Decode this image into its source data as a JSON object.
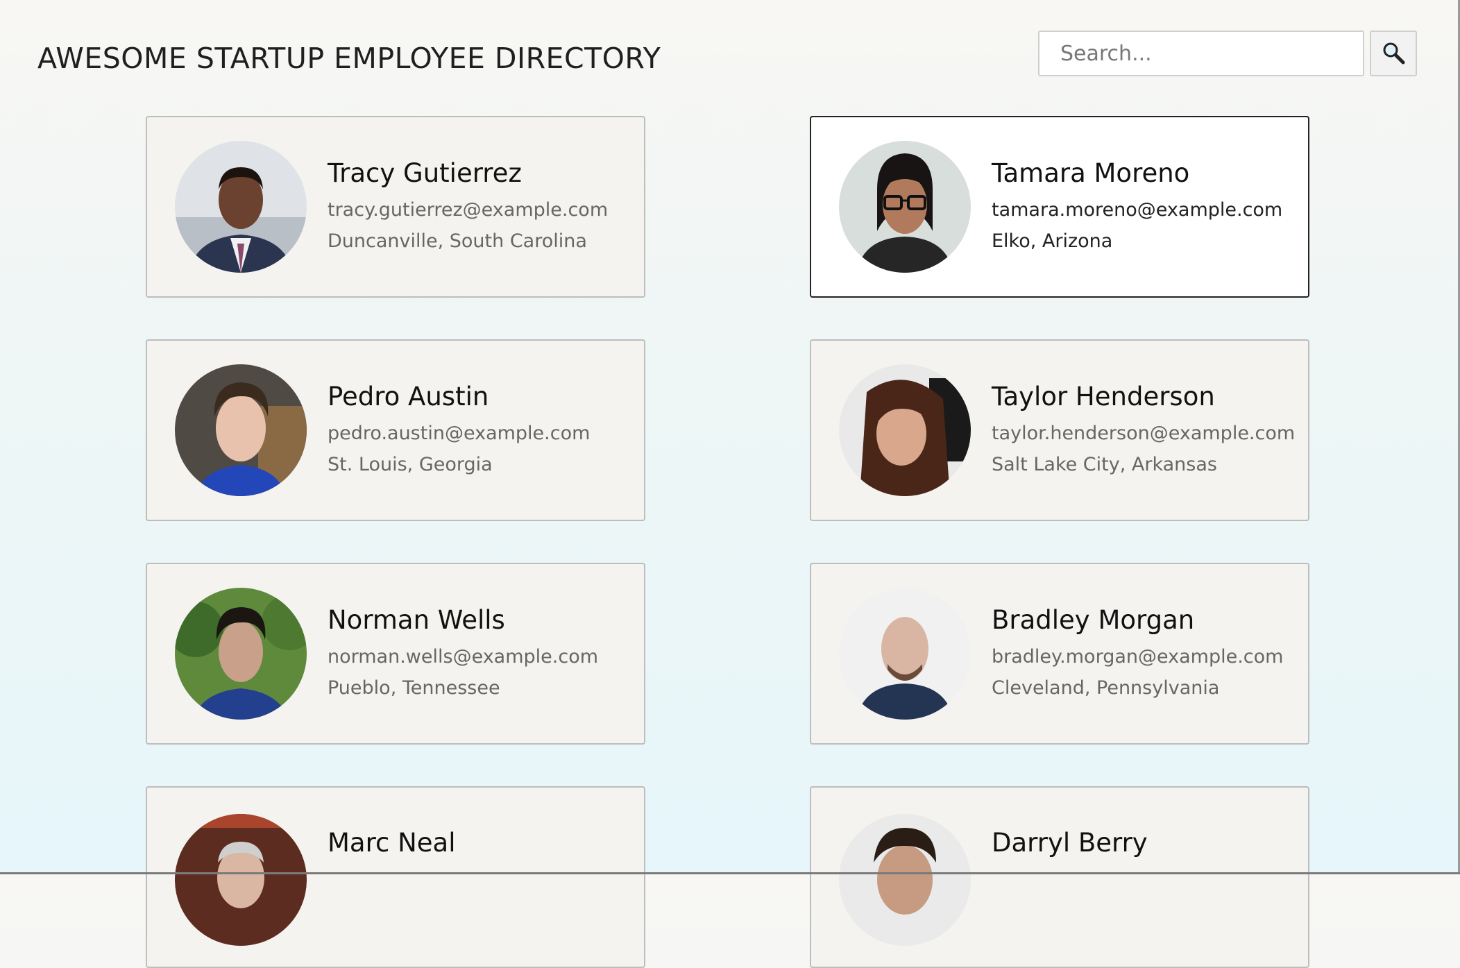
{
  "header": {
    "title": "AWESOME STARTUP EMPLOYEE DIRECTORY"
  },
  "search": {
    "placeholder": "Search...",
    "icon": "magnifier-icon"
  },
  "employees": [
    {
      "name": "Tracy Gutierrez",
      "email": "tracy.gutierrez@example.com",
      "location": "Duncanville, South Carolina",
      "selected": false
    },
    {
      "name": "Tamara Moreno",
      "email": "tamara.moreno@example.com",
      "location": "Elko, Arizona",
      "selected": true
    },
    {
      "name": "Pedro Austin",
      "email": "pedro.austin@example.com",
      "location": "St. Louis, Georgia",
      "selected": false
    },
    {
      "name": "Taylor Henderson",
      "email": "taylor.henderson@example.com",
      "location": "Salt Lake City, Arkansas",
      "selected": false
    },
    {
      "name": "Norman Wells",
      "email": "norman.wells@example.com",
      "location": "Pueblo, Tennessee",
      "selected": false
    },
    {
      "name": "Bradley Morgan",
      "email": "bradley.morgan@example.com",
      "location": "Cleveland, Pennsylvania",
      "selected": false
    },
    {
      "name": "Marc Neal",
      "email": "",
      "location": "",
      "selected": false
    },
    {
      "name": "Darryl Berry",
      "email": "",
      "location": "",
      "selected": false
    }
  ],
  "colors": {
    "card_bg": "#f4f3ef",
    "card_selected_bg": "#ffffff",
    "card_border": "#bdbdbd",
    "card_selected_border": "#222222"
  }
}
